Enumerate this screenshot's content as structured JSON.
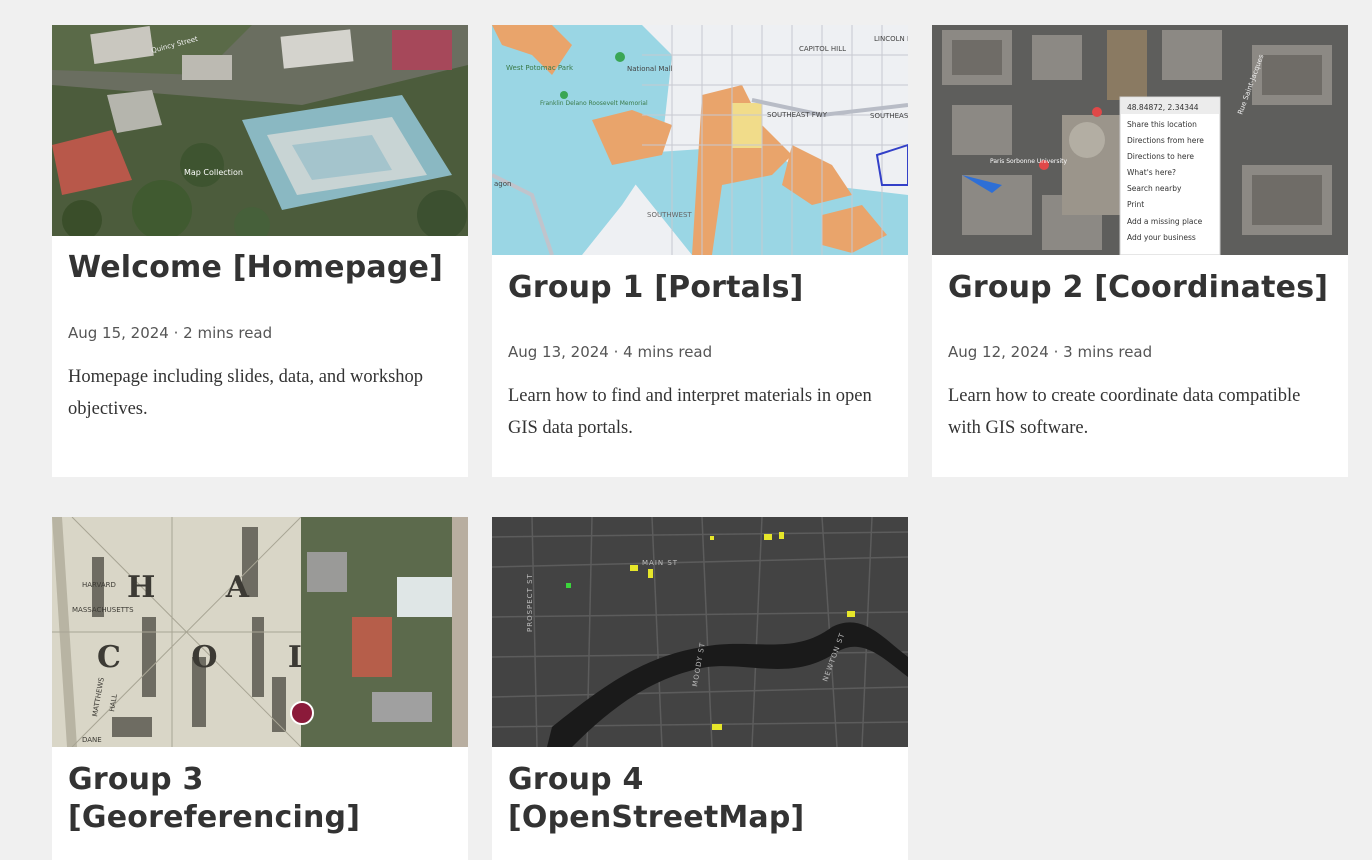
{
  "posts": [
    {
      "title": "Welcome [Homepage]",
      "date": "Aug 15, 2024",
      "read_time": "2 mins read",
      "description": "Homepage including slides, data, and workshop objectives.",
      "thumbnail": {
        "kind": "aerial-3d",
        "labels": [
          "Quincy Street",
          "Map Collection"
        ]
      }
    },
    {
      "title": "Group 1 [Portals]",
      "date": "Aug 13, 2024",
      "read_time": "4 mins read",
      "description": "Learn how to find and interpret materials in open GIS data portals.",
      "thumbnail": {
        "kind": "flood-map",
        "labels": [
          "National Mall",
          "West Potomac Park",
          "Franklin Delano Roosevelt Memorial",
          "CAPITOL HILL",
          "LINCOLN PARK",
          "SOUTHEAST FWY",
          "SOUTHEAS",
          "SOUTHWEST",
          "agon"
        ]
      }
    },
    {
      "title": "Group 2 [Coordinates]",
      "date": "Aug 12, 2024",
      "read_time": "3 mins read",
      "description": "Learn how to create coordinate data compatible with GIS software.",
      "thumbnail": {
        "kind": "satellite-context-menu",
        "labels": [
          "Rue Saint-Jacques",
          "Paris Sorbonne University"
        ],
        "context_menu": [
          "48.84872, 2.34344",
          "Share this location",
          "Directions from here",
          "Directions to here",
          "What's here?",
          "Search nearby",
          "Print",
          "Add a missing place",
          "Add your business"
        ]
      }
    },
    {
      "title": "Group 3 [Georeferencing]",
      "date": "",
      "read_time": "",
      "description": "",
      "thumbnail": {
        "kind": "historic-map-overlay",
        "labels": [
          "H A R V",
          "C O L L",
          "HARVARD",
          "MASSACHUSETTS",
          "MATTHEWS",
          "HALL",
          "DANE"
        ]
      }
    },
    {
      "title": "Group 4 [OpenStreetMap]",
      "date": "",
      "read_time": "",
      "description": "",
      "thumbnail": {
        "kind": "dark-street-map",
        "labels": [
          "MAIN ST",
          "PROSPECT ST",
          "MOODY ST",
          "NEWTON ST"
        ]
      }
    }
  ],
  "meta_separator": " · "
}
